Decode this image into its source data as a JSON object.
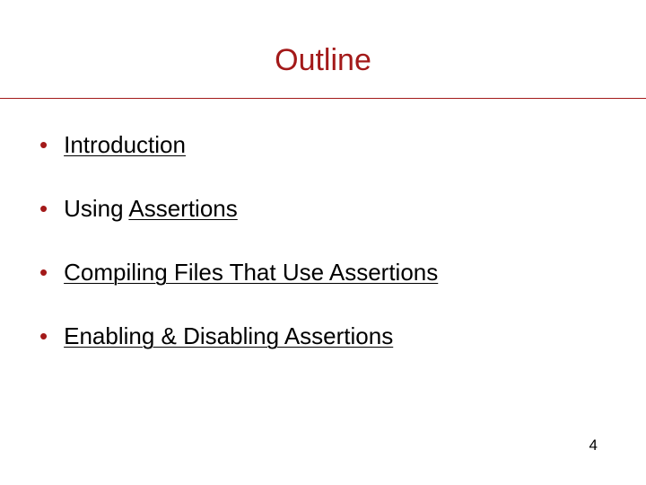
{
  "title": "Outline",
  "items": [
    {
      "parts": [
        {
          "text": "Introduction",
          "link": true
        }
      ]
    },
    {
      "parts": [
        {
          "text": "Using ",
          "link": false
        },
        {
          "text": "Assertions",
          "link": true
        }
      ]
    },
    {
      "parts": [
        {
          "text": "Compiling Files That Use Assertions",
          "link": true
        }
      ]
    },
    {
      "parts": [
        {
          "text": "Enabling & Disabling Assertions",
          "link": true
        }
      ]
    }
  ],
  "page_number": "4"
}
